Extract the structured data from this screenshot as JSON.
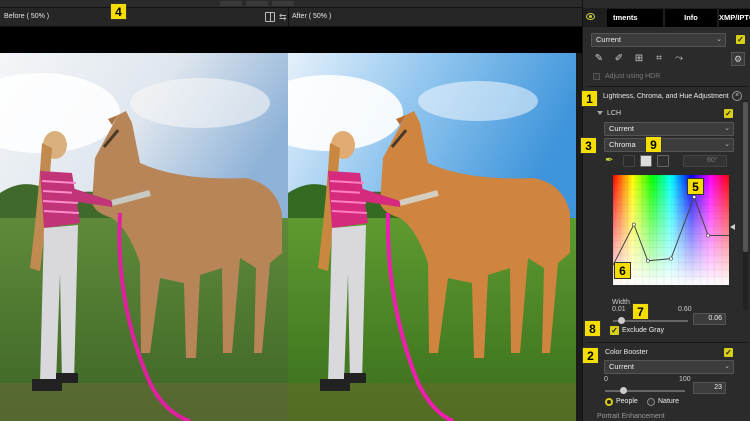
{
  "viewer": {
    "before_label": "Before ( 50% )",
    "after_label": "After ( 50% )"
  },
  "panel": {
    "tabs": {
      "adjustments": "tments",
      "info": "Info",
      "xmp": "XMP/IPTC"
    },
    "preset": "Current",
    "hdr_label": "Adjust using HDR",
    "lch": {
      "title": "Lightness, Chroma, and Hue Adjustment",
      "sub_label": "LCH",
      "preset": "Current",
      "mode": "Chroma",
      "angle": "60°",
      "width_label": "Width",
      "width_min": "0.01",
      "width_max": "0.60",
      "width_value": "0.06",
      "width_level": 0.1,
      "exclude_gray_label": "Exclude Gray",
      "curve_points": [
        [
          0,
          0.18
        ],
        [
          0.18,
          0.55
        ],
        [
          0.3,
          0.22
        ],
        [
          0.5,
          0.24
        ],
        [
          0.7,
          0.8
        ],
        [
          0.82,
          0.45
        ],
        [
          1,
          0.45
        ]
      ]
    },
    "color_booster": {
      "title": "Color Booster",
      "preset": "Current",
      "min": "0",
      "max": "100",
      "value": "23",
      "level": 0.23,
      "people_label": "People",
      "nature_label": "Nature"
    },
    "portrait_label": "Portrait Enhancement"
  },
  "badges": [
    "1",
    "2",
    "3",
    "4",
    "5",
    "6",
    "7",
    "8",
    "9"
  ],
  "colors": {
    "accent": "#d8d016",
    "badge": "#f5dd00"
  }
}
